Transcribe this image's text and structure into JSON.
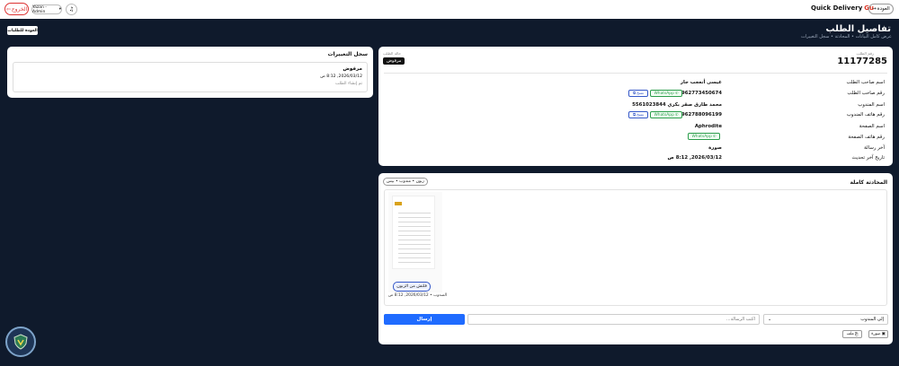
{
  "topbar": {
    "logout_label": "الخروج",
    "logout_icon": "logout-icon",
    "user_label": "Yazan - Admin",
    "bell_icon": "bell-icon",
    "brand_title": "Quick Delivery",
    "brand_logo": "Gu",
    "back_label": "العودة",
    "accent": "#d33333"
  },
  "header": {
    "title": "تفاصيل الطلب",
    "breadcrumb": "عرض كامل البيانات • المحادثة • سجل التغييرات",
    "back_orders_label": "العودة للطلبات"
  },
  "changelog": {
    "title": "سجل التغييرات",
    "entry_status": "مرفوض",
    "entry_date": "2026/03/12, 8:12 ص",
    "entry_note": "تم إنشاء الطلب"
  },
  "order": {
    "number_label": "رقم الطلب",
    "number": "11177285",
    "status_label": "حالة الطلب",
    "status": "مرفوض",
    "fields": [
      {
        "label": "اسم صاحب الطلب",
        "value": "عيسى أنعجب جار"
      },
      {
        "label": "رقم صاحب الطلب",
        "value": "962773450674"
      },
      {
        "label": "اسم المندوب",
        "value": "محمد طارق صقر بكري 5561023844"
      },
      {
        "label": "رقم هاتف المندوب",
        "value": "962788096199"
      },
      {
        "label": "اسم الصفحة",
        "value": "Aphrodite"
      },
      {
        "label": "رقم هاتف الصفحة",
        "value": ""
      },
      {
        "label": "آخر رسالة",
        "value": "صورة"
      },
      {
        "label": "تاريخ آخر تحديث",
        "value": "2026/03/12, 8:12 ص"
      }
    ],
    "whatsapp_label": "WhatsApp",
    "copy_label": "نسخ"
  },
  "chat": {
    "title": "المحادثة كاملة",
    "roles_label": "زبون • مندوب • بيس",
    "message_caption": "فلتش من الزبون",
    "message_meta": "المندوب • 2026/03/12, 8:12 ص",
    "recipient": "إلى المندوب",
    "input_placeholder": "اكتب الرسالة...",
    "send_label": "إرسال",
    "image_label": "صورة",
    "file_label": "ملف",
    "send_color": "#1f6bff"
  }
}
